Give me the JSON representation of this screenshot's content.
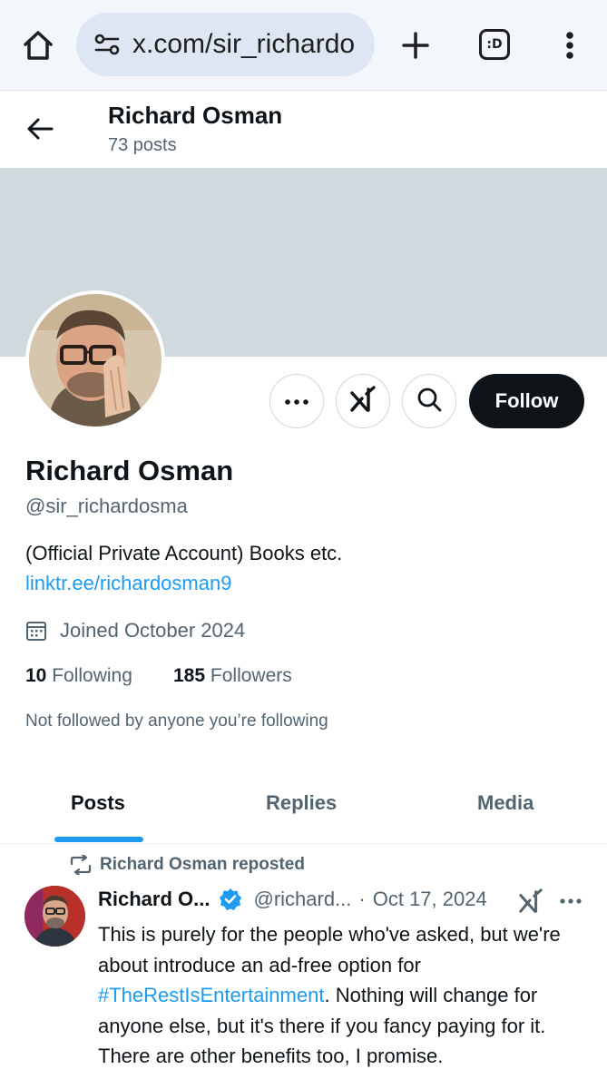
{
  "browser": {
    "url": "x.com/sir_richardo",
    "tabs_label": ":D"
  },
  "header": {
    "name": "Richard Osman",
    "posts_count": "73 posts"
  },
  "profile": {
    "name": "Richard Osman",
    "handle": "@sir_richardosma",
    "bio": "(Official Private Account) Books etc.",
    "link": "linktr.ee/richardosman9",
    "joined": "Joined October 2024",
    "following_count": "10",
    "following_label": "Following",
    "followers_count": "185",
    "followers_label": "Followers",
    "not_followed": "Not followed by anyone you’re following",
    "follow_label": "Follow"
  },
  "tabs": [
    {
      "label": "Posts",
      "active": true
    },
    {
      "label": "Replies",
      "active": false
    },
    {
      "label": "Media",
      "active": false
    }
  ],
  "post": {
    "repost_label": "Richard Osman reposted",
    "author": "Richard O...",
    "handle": "@richard...",
    "separator": "·",
    "date": "Oct 17, 2024",
    "body_1": "This is purely for the people who've asked, but we're about introduce an ad-free option for ",
    "hashtag": "#TheRestIsEntertainment",
    "body_2": ". Nothing will change for anyone else, but it's there if you fancy paying for it. There are other benefits too, I promise."
  },
  "colors": {
    "accent": "#1d9bf0",
    "text_primary": "#0f1419",
    "text_secondary": "#536471",
    "banner": "#cfd9de"
  },
  "icons": [
    "home-icon",
    "site-settings-icon",
    "new-tab-plus-icon",
    "tab-switcher-icon",
    "browser-menu-icon",
    "back-arrow-icon",
    "more-icon",
    "grok-icon",
    "search-icon",
    "calendar-icon",
    "repost-icon",
    "verified-badge-icon"
  ]
}
